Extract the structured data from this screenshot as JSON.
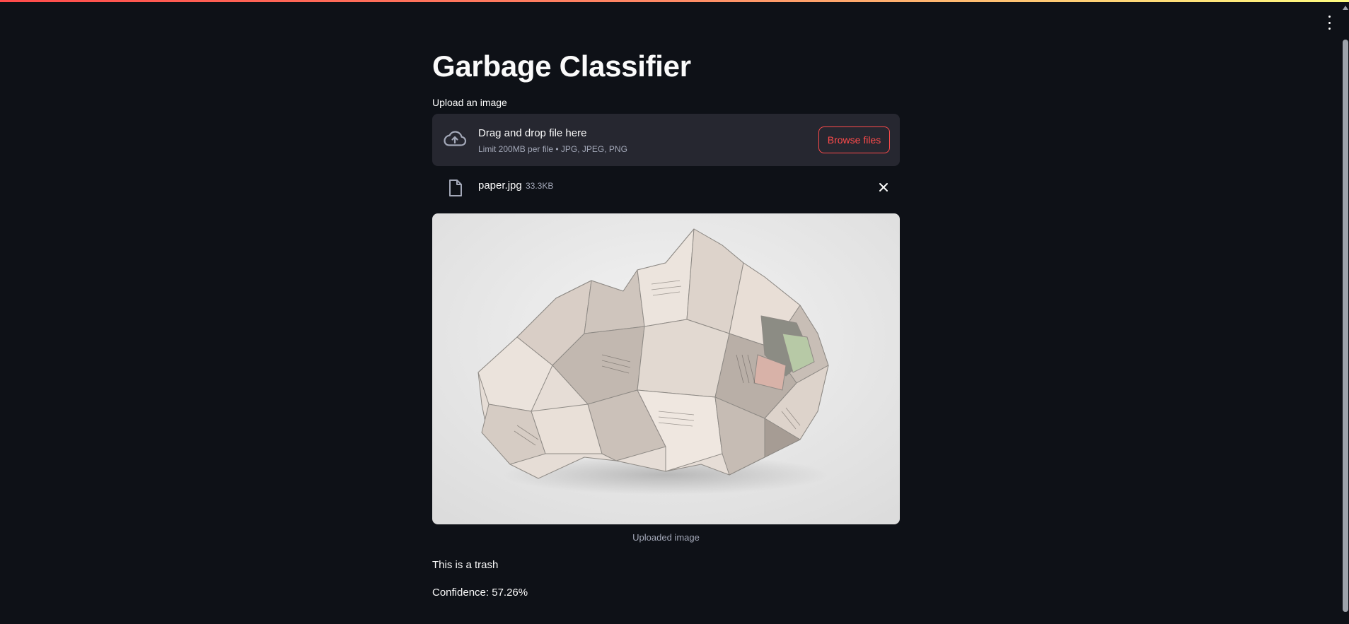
{
  "app": {
    "title": "Garbage Classifier"
  },
  "uploader": {
    "label": "Upload an image",
    "drop_title": "Drag and drop file here",
    "limit_text": "Limit 200MB per file • JPG, JPEG, PNG",
    "browse_label": "Browse files",
    "icon": "cloud-upload-icon"
  },
  "file": {
    "name": "paper.jpg",
    "size": "33.3KB",
    "icon": "file-icon",
    "remove_icon": "close-icon"
  },
  "image": {
    "caption": "Uploaded image"
  },
  "result": {
    "prediction_text": "This is a trash",
    "confidence_text": "Confidence: 57.26%"
  },
  "colors": {
    "background": "#0e1117",
    "dropzone": "#262730",
    "accent": "#ff4b4b",
    "muted_text": "#a3a8b8"
  }
}
